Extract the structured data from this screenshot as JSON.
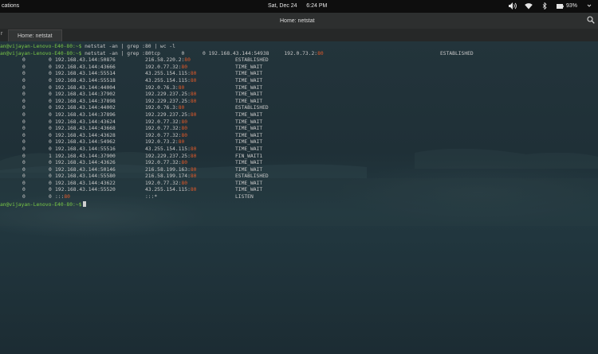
{
  "topbar": {
    "activities": "cations",
    "clock_day": "Sat, Dec 24",
    "clock_time": "6:24 PM",
    "battery": "93%"
  },
  "window": {
    "title": "Home: netstat",
    "tab_title": "Home: netstat"
  },
  "terminal": {
    "prompt": "an@vijayan-Lenovo-E40-80:~$",
    "command1": " netstat -an | grep :80 | wc -l",
    "command2_before": " netstat -an | grep :80tcp       0      0 192.168.43.144:54938     192.0.73.2:",
    "command2_port": "80",
    "command2_state": "ESTABLISHED",
    "rows": [
      {
        "q": "0",
        "s": "0",
        "local": "192.168.43.144:50876",
        "remote": "216.58.220.2:",
        "state": "ESTABLISHED"
      },
      {
        "q": "0",
        "s": "0",
        "local": "192.168.43.144:43666",
        "remote": "192.0.77.32:",
        "state": "TIME_WAIT"
      },
      {
        "q": "0",
        "s": "0",
        "local": "192.168.43.144:55514",
        "remote": "43.255.154.115:",
        "state": "TIME_WAIT"
      },
      {
        "q": "0",
        "s": "0",
        "local": "192.168.43.144:55518",
        "remote": "43.255.154.115:",
        "state": "TIME_WAIT"
      },
      {
        "q": "0",
        "s": "0",
        "local": "192.168.43.144:44004",
        "remote": "192.0.76.3:",
        "state": "TIME_WAIT"
      },
      {
        "q": "0",
        "s": "0",
        "local": "192.168.43.144:37902",
        "remote": "192.229.237.25:",
        "state": "TIME_WAIT"
      },
      {
        "q": "0",
        "s": "0",
        "local": "192.168.43.144:37898",
        "remote": "192.229.237.25:",
        "state": "TIME_WAIT"
      },
      {
        "q": "0",
        "s": "0",
        "local": "192.168.43.144:44002",
        "remote": "192.0.76.3:",
        "state": "ESTABLISHED"
      },
      {
        "q": "0",
        "s": "0",
        "local": "192.168.43.144:37896",
        "remote": "192.229.237.25:",
        "state": "TIME_WAIT"
      },
      {
        "q": "0",
        "s": "0",
        "local": "192.168.43.144:43624",
        "remote": "192.0.77.32:",
        "state": "TIME_WAIT"
      },
      {
        "q": "0",
        "s": "0",
        "local": "192.168.43.144:43668",
        "remote": "192.0.77.32:",
        "state": "TIME_WAIT"
      },
      {
        "q": "0",
        "s": "0",
        "local": "192.168.43.144:43628",
        "remote": "192.0.77.32:",
        "state": "TIME_WAIT"
      },
      {
        "q": "0",
        "s": "0",
        "local": "192.168.43.144:54962",
        "remote": "192.0.73.2:",
        "state": "TIME_WAIT"
      },
      {
        "q": "0",
        "s": "0",
        "local": "192.168.43.144:55516",
        "remote": "43.255.154.115:",
        "state": "TIME_WAIT"
      },
      {
        "q": "0",
        "s": "1",
        "local": "192.168.43.144:37900",
        "remote": "192.229.237.25:",
        "state": "FIN_WAIT1"
      },
      {
        "q": "0",
        "s": "0",
        "local": "192.168.43.144:43626",
        "remote": "192.0.77.32:",
        "state": "TIME_WAIT"
      },
      {
        "q": "0",
        "s": "0",
        "local": "192.168.43.144:50146",
        "remote": "216.58.199.163:",
        "state": "TIME_WAIT"
      },
      {
        "q": "0",
        "s": "0",
        "local": "192.168.43.144:55580",
        "remote": "216.58.199.174:",
        "state": "ESTABLISHED"
      },
      {
        "q": "0",
        "s": "0",
        "local": "192.168.43.144:43622",
        "remote": "192.0.77.32:",
        "state": "TIME_WAIT"
      },
      {
        "q": "0",
        "s": "0",
        "local": "192.168.43.144:55520",
        "remote": "43.255.154.115:",
        "state": "TIME_WAIT"
      }
    ],
    "port": "80",
    "listen_row": {
      "q": "0",
      "s": "0",
      "local_prefix": ":::",
      "local_port": "80",
      "remote": ":::*",
      "state": "LISTEN"
    },
    "final_prompt": "an@vijayan-Lenovo-E40-80:~$"
  },
  "colors": {
    "prompt": "#79c846",
    "port": "#e05a2a",
    "text": "#c8c8c8"
  },
  "icons": [
    "volume-icon",
    "wifi-icon",
    "bluetooth-icon",
    "battery-icon",
    "search-icon"
  ]
}
